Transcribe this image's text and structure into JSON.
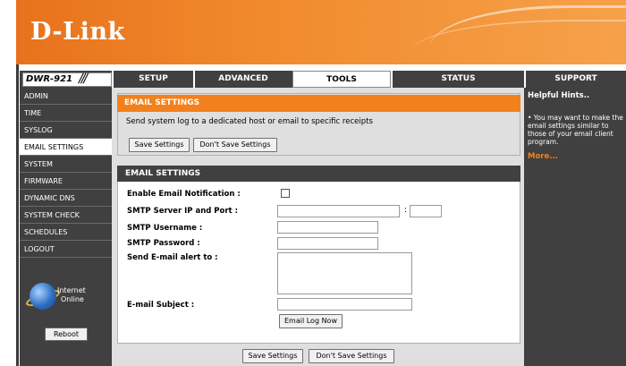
{
  "brand": {
    "logo": "D-Link",
    "model": "DWR-921"
  },
  "nav_tabs": [
    {
      "label": "SETUP"
    },
    {
      "label": "ADVANCED"
    },
    {
      "label": "TOOLS",
      "active": true
    },
    {
      "label": "STATUS"
    },
    {
      "label": "SUPPORT"
    }
  ],
  "sidebar": {
    "items": [
      {
        "label": "ADMIN"
      },
      {
        "label": "TIME"
      },
      {
        "label": "SYSLOG"
      },
      {
        "label": "EMAIL SETTINGS",
        "active": true
      },
      {
        "label": "SYSTEM"
      },
      {
        "label": "FIRMWARE"
      },
      {
        "label": "DYNAMIC DNS"
      },
      {
        "label": "SYSTEM CHECK"
      },
      {
        "label": "SCHEDULES"
      },
      {
        "label": "LOGOUT"
      }
    ],
    "internet_status": {
      "line1": "Internet",
      "line2": "Online"
    },
    "reboot_label": "Reboot"
  },
  "top_panel": {
    "title": "EMAIL SETTINGS",
    "description": "Send system log to a dedicated host or email to specific receipts",
    "save_label": "Save Settings",
    "dont_save_label": "Don't Save Settings"
  },
  "form_panel": {
    "title": "EMAIL SETTINGS",
    "enable_label": "Enable Email Notification :",
    "enable_checked": false,
    "smtp_server_label": "SMTP Server IP and Port :",
    "smtp_server_value": "",
    "smtp_port_value": "",
    "smtp_username_label": "SMTP Username :",
    "smtp_username_value": "",
    "smtp_password_label": "SMTP Password :",
    "send_alert_label": "Send E-mail alert to :",
    "send_alert_value": "",
    "subject_label": "E-mail Subject :",
    "subject_value": "",
    "email_log_now_label": "Email Log Now"
  },
  "bottom_buttons": {
    "save_label": "Save Settings",
    "dont_save_label": "Don't Save Settings"
  },
  "hints": {
    "title": "Helpful Hints..",
    "text": "• You may want to make the email settings similar to those of your email client program.",
    "more_label": "More..."
  },
  "colors": {
    "accent_orange": "#f2811d",
    "nav_dark": "#404040",
    "panel_gray": "#dfdfdf"
  }
}
